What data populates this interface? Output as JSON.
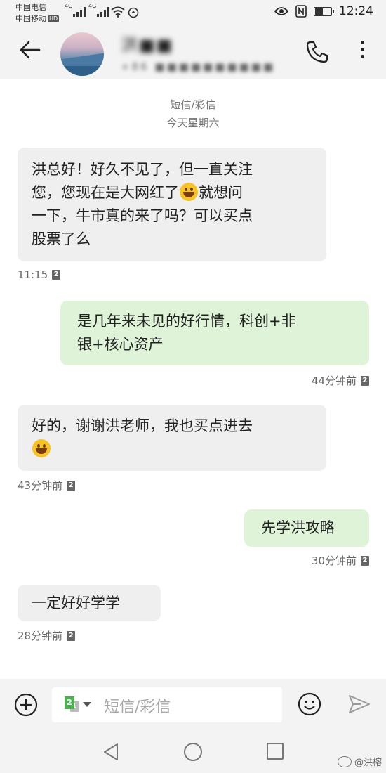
{
  "status_bar": {
    "carrier_1": "中国电信",
    "carrier_2": "中国移动",
    "carrier_2_badge": "HD",
    "signal_1_label": "4G",
    "signal_2_label": "4G",
    "time": "12:24"
  },
  "header": {
    "contact_name": "洪■■",
    "contact_number": "+86 ■■■■■■■■■■"
  },
  "thread": {
    "type_label": "短信/彩信",
    "day_label": "今天星期六"
  },
  "messages": [
    {
      "direction": "incoming",
      "lines": [
        "洪总好！好久不见了，但一直关注",
        "您，您现在是大网红了",
        "就想问",
        "一下，牛市真的来了吗？可以买点",
        "股票了么"
      ],
      "time": "11:15",
      "sim": "2"
    },
    {
      "direction": "outgoing",
      "lines": [
        "是几年来未见的好行情，科创+非",
        "银+核心资产"
      ],
      "time": "44分钟前",
      "sim": "2"
    },
    {
      "direction": "incoming",
      "lines": [
        "好的，谢谢洪老师，我也买点进去"
      ],
      "time": "43分钟前",
      "sim": "2"
    },
    {
      "direction": "outgoing",
      "lines": [
        "先学洪攻略"
      ],
      "time": "30分钟前",
      "sim": "2"
    },
    {
      "direction": "incoming",
      "lines": [
        "一定好好学学"
      ],
      "time": "28分钟前",
      "sim": "2"
    }
  ],
  "composer": {
    "placeholder": "短信/彩信",
    "sim_selected": "2",
    "sim_other": "1"
  },
  "watermark": {
    "text": "@洪榕"
  },
  "colors": {
    "incoming_bubble": "#efefef",
    "outgoing_bubble": "#dff3d9",
    "bar_background": "#f3f3f3"
  },
  "icons": [
    "back-arrow-icon",
    "phone-icon",
    "more-vert-icon",
    "add-circle-icon",
    "emoji-icon",
    "send-icon",
    "nav-back-icon",
    "nav-home-icon",
    "nav-recent-icon",
    "weibo-icon",
    "wifi-icon",
    "eye-icon",
    "nfc-icon",
    "battery-icon"
  ]
}
